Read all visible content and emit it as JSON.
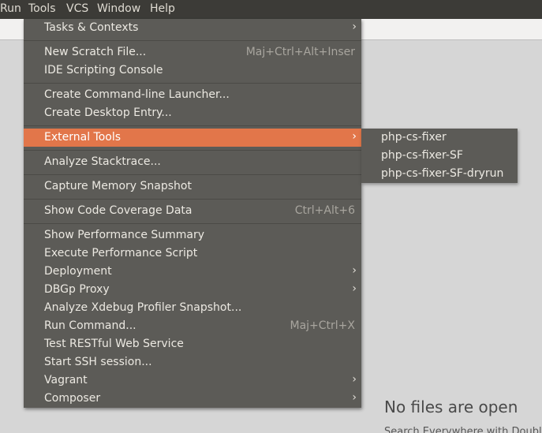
{
  "menubar": {
    "items": [
      {
        "label": "Run"
      },
      {
        "label": "Tools"
      },
      {
        "label": "VCS"
      },
      {
        "label": "Window"
      },
      {
        "label": "Help"
      }
    ]
  },
  "tools_menu": {
    "items": [
      {
        "label": "Tasks & Contexts",
        "shortcut": "",
        "submenu": true
      },
      {
        "label": "New Scratch File...",
        "shortcut": "Maj+Ctrl+Alt+Inser"
      },
      {
        "label": "IDE Scripting Console",
        "shortcut": ""
      },
      {
        "label": "Create Command-line Launcher...",
        "shortcut": ""
      },
      {
        "label": "Create Desktop Entry...",
        "shortcut": ""
      },
      {
        "label": "External Tools",
        "shortcut": "",
        "submenu": true,
        "active": true
      },
      {
        "label": "Analyze Stacktrace...",
        "shortcut": ""
      },
      {
        "label": "Capture Memory Snapshot",
        "shortcut": ""
      },
      {
        "label": "Show Code Coverage Data",
        "shortcut": "Ctrl+Alt+6"
      },
      {
        "label": "Show Performance Summary",
        "shortcut": ""
      },
      {
        "label": "Execute Performance Script",
        "shortcut": ""
      },
      {
        "label": "Deployment",
        "shortcut": "",
        "submenu": true
      },
      {
        "label": "DBGp Proxy",
        "shortcut": "",
        "submenu": true
      },
      {
        "label": "Analyze Xdebug Profiler Snapshot...",
        "shortcut": ""
      },
      {
        "label": "Run Command...",
        "shortcut": "Maj+Ctrl+X"
      },
      {
        "label": "Test RESTful Web Service",
        "shortcut": ""
      },
      {
        "label": "Start SSH session...",
        "shortcut": ""
      },
      {
        "label": "Vagrant",
        "shortcut": "",
        "submenu": true
      },
      {
        "label": "Composer",
        "shortcut": "",
        "submenu": true
      }
    ],
    "submenu_arrow": "›"
  },
  "external_tools_submenu": {
    "items": [
      {
        "label": "php-cs-fixer"
      },
      {
        "label": "php-cs-fixer-SF"
      },
      {
        "label": "php-cs-fixer-SF-dryrun"
      }
    ]
  },
  "editor": {
    "empty_title": "No files are open",
    "empty_hint": "Search Everywhere with Double"
  },
  "colors": {
    "menu_bg": "#5c5b57",
    "menubar_bg": "#3c3b37",
    "highlight": "#e2764a",
    "editor_bg": "#d6d6d6"
  }
}
